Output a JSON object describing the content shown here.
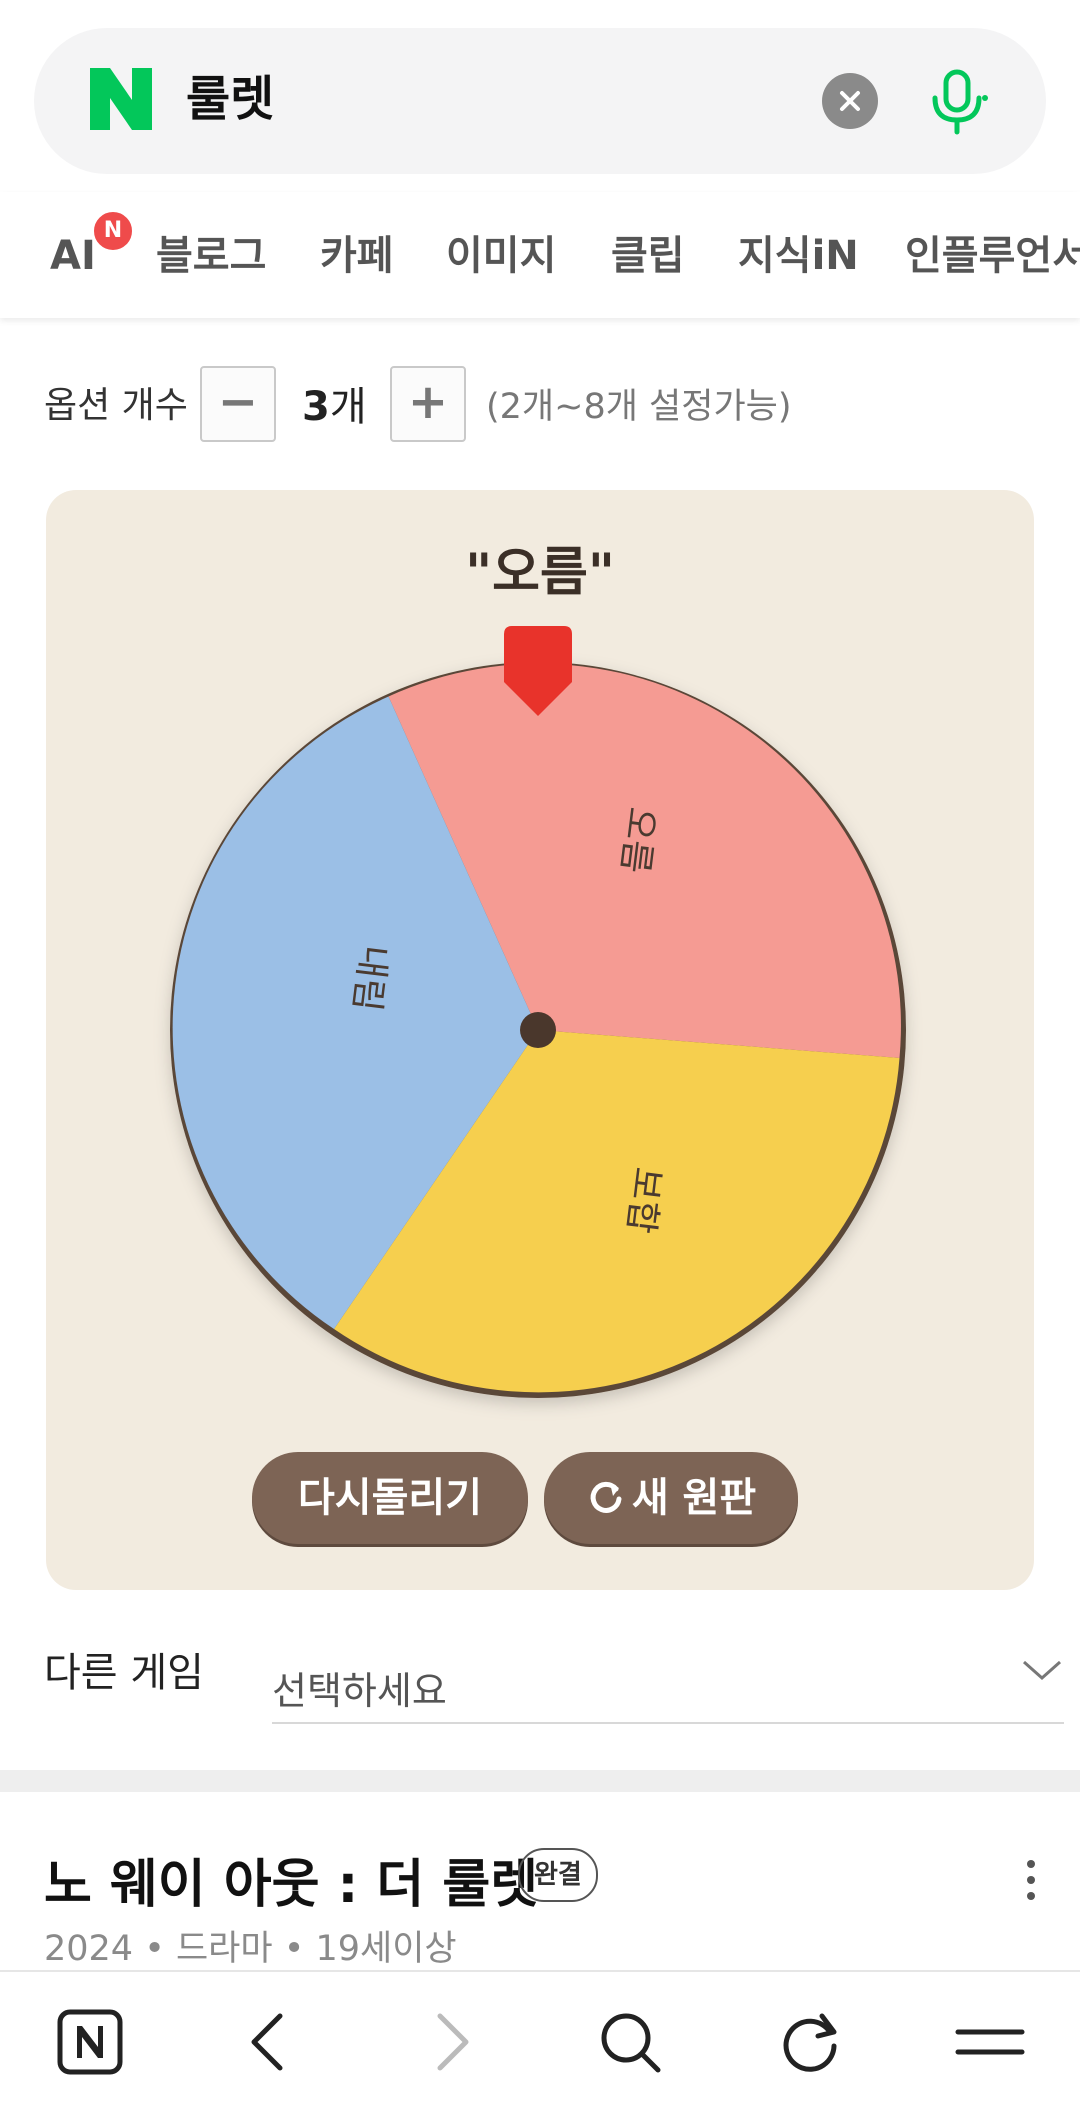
{
  "search": {
    "query": "룰렛",
    "clear_icon": "close-icon",
    "voice_icon": "mic-icon",
    "brand_color": "#03c75a"
  },
  "tabs": {
    "ai_label": "AI",
    "ai_badge": "N",
    "items": [
      "블로그",
      "카페",
      "이미지",
      "클립",
      "지식iN",
      "인플루언서"
    ]
  },
  "options": {
    "label": "옵션 개수",
    "minus": "−",
    "plus": "+",
    "count": "3",
    "unit": "개",
    "range": "(2개~8개 설정가능)"
  },
  "roulette": {
    "result": "\"오름\"",
    "segments": [
      {
        "label": "오름",
        "color": "#f59b93"
      },
      {
        "label": "보합",
        "color": "#f6cf4e"
      },
      {
        "label": "내림",
        "color": "#9bbfe6"
      }
    ],
    "pointer_color": "#e8332b",
    "respin_label": "다시돌리기",
    "new_wheel_label": "새 원판",
    "new_wheel_icon": "refresh-icon"
  },
  "other_game": {
    "label": "다른 게임",
    "placeholder": "선택하세요"
  },
  "result_item": {
    "title": "노 웨이 아웃 : 더 룰렛",
    "badge": "완결",
    "meta": "2024 • 드라마 • 19세이상"
  },
  "bottom_nav": [
    "home-icon",
    "back-icon",
    "forward-icon",
    "search-icon",
    "reload-icon",
    "menu-icon"
  ]
}
